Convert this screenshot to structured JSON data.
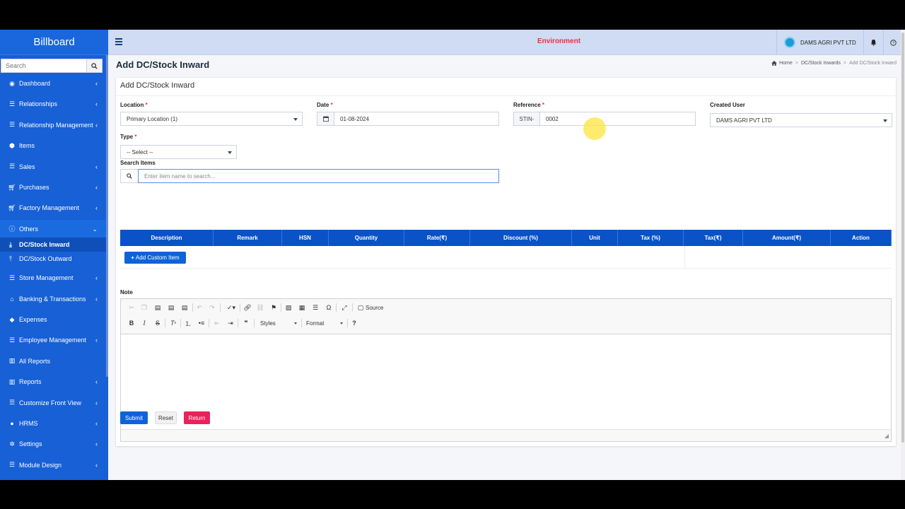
{
  "sidebar": {
    "brand": "Billboard",
    "search_placeholder": "Search",
    "items": [
      {
        "label": "Dashboard",
        "icon": "dashboard-icon",
        "chevron": true
      },
      {
        "label": "Relationships",
        "icon": "list-icon",
        "chevron": true
      },
      {
        "label": "Relationship Management",
        "icon": "list-icon",
        "chevron": true
      },
      {
        "label": "Items",
        "icon": "cubes-icon",
        "chevron": false
      },
      {
        "label": "Sales",
        "icon": "list-icon",
        "chevron": true
      },
      {
        "label": "Purchases",
        "icon": "cart-icon",
        "chevron": true
      },
      {
        "label": "Factory Management",
        "icon": "cart-icon",
        "chevron": true
      },
      {
        "label": "Others",
        "icon": "info-icon",
        "chevron": true
      },
      {
        "label": "Store Management",
        "icon": "list-icon",
        "chevron": true
      },
      {
        "label": "Banking & Transactions",
        "icon": "bank-icon",
        "chevron": true
      },
      {
        "label": "Expenses",
        "icon": "diamond-icon",
        "chevron": false
      },
      {
        "label": "Employee Management",
        "icon": "list-icon",
        "chevron": true
      },
      {
        "label": "All Reports",
        "icon": "bar-chart-icon",
        "chevron": false
      },
      {
        "label": "Reports",
        "icon": "bar-chart-icon",
        "chevron": true
      },
      {
        "label": "Customize Front View",
        "icon": "list-icon",
        "chevron": true
      },
      {
        "label": "HRMS",
        "icon": "globe-icon",
        "chevron": true
      },
      {
        "label": "Settings",
        "icon": "cogs-icon",
        "chevron": true
      },
      {
        "label": "Module Design",
        "icon": "list-icon",
        "chevron": true
      }
    ],
    "subitems": [
      {
        "label": "DC/Stock Inward",
        "icon": "download-icon",
        "active": true
      },
      {
        "label": "DC/Stock Outward",
        "icon": "upload-icon",
        "active": false
      }
    ]
  },
  "topbar": {
    "environment": "Environment",
    "company": "DAMS AGRI PVT LTD"
  },
  "page": {
    "title": "Add DC/Stock Inward",
    "breadcrumb": [
      "Home",
      "DC/Stock Inwards",
      "Add DC/Stock Inward"
    ],
    "card_title": "Add DC/Stock Inward"
  },
  "form": {
    "location_label": "Location",
    "location_value": "Primary Location (1)",
    "date_label": "Date",
    "date_value": "01-08-2024",
    "reference_label": "Reference",
    "reference_prefix": "STIN-",
    "reference_value": "0002",
    "created_user_label": "Created User",
    "created_user_value": "DAMS AGRI PVT LTD",
    "type_label": "Type",
    "type_value": "-- Select --",
    "search_items_label": "Search Items",
    "search_items_placeholder": "Enter item name to search...",
    "required_mark": "*"
  },
  "table": {
    "headers": [
      "Description",
      "Remark",
      "HSN",
      "Quantity",
      "Rate(₹)",
      "Discount (%)",
      "Unit",
      "Tax (%)",
      "Tax(₹)",
      "Amount(₹)",
      "Action"
    ],
    "add_custom_label": "Add Custom Item"
  },
  "note": {
    "label": "Note",
    "source_label": "Source",
    "styles_label": "Styles",
    "format_label": "Format"
  },
  "actions": {
    "submit": "Submit",
    "reset": "Reset",
    "return": "Return"
  },
  "colors": {
    "sidebar": "#1760d6",
    "topbar": "#cfdcf3",
    "table_header": "#0b52c9",
    "primary": "#0f63d8",
    "danger": "#e8235a",
    "environment": "#e53345"
  }
}
